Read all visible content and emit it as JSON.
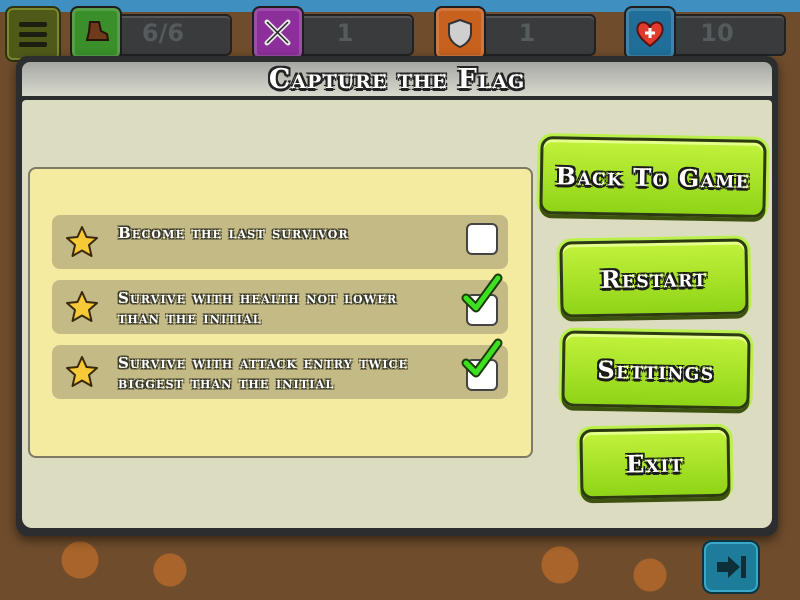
{
  "hud": {
    "menu_icon": "hamburger-icon",
    "stats": [
      {
        "icon": "boot-icon",
        "value": "6/6",
        "color": "#3a8f2a"
      },
      {
        "icon": "swords-icon",
        "value": "1",
        "color": "#8c2f9a"
      },
      {
        "icon": "shield-icon",
        "value": "1",
        "color": "#c8601e"
      },
      {
        "icon": "heart-plus-icon",
        "value": "10",
        "color": "#1f6f9a"
      }
    ]
  },
  "dialog": {
    "title": "Capture the Flag",
    "objectives": [
      {
        "text": "Become the last survivor",
        "completed": false,
        "icon": "star-icon"
      },
      {
        "text": "Survive with health not lower than the initial",
        "completed": true,
        "icon": "star-icon"
      },
      {
        "text": "Survive with attack entry twice biggest than the initial",
        "completed": true,
        "icon": "star-icon"
      }
    ],
    "buttons": {
      "back_to_game": "Back To Game",
      "restart": "Restart",
      "settings": "Settings",
      "exit": "Exit"
    }
  },
  "bottom": {
    "skip_icon": "skip-forward-icon"
  },
  "colors": {
    "button_green": "#a6e52a",
    "panel_yellow": "#f4eaa0",
    "row_tan": "#c4ba86",
    "check_green": "#3ce021"
  }
}
